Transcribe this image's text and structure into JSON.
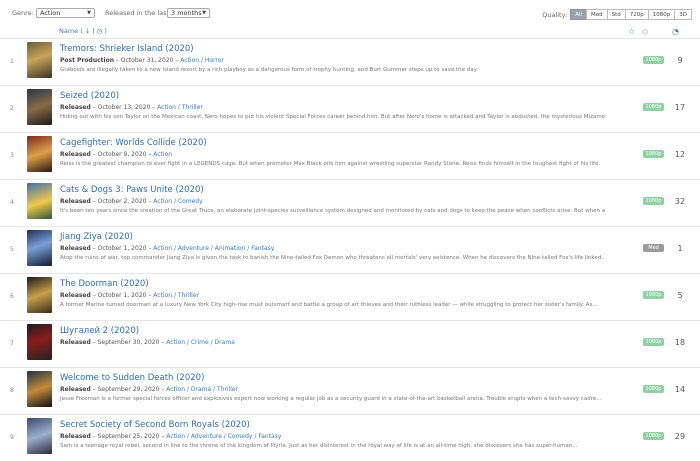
{
  "filters": {
    "genre_label": "Genre:",
    "genre_value": "Action",
    "released_label": "Released in the last:",
    "released_value": "3 months",
    "quality_label": "Quality:",
    "quality_options": [
      "All",
      "Med",
      "Std",
      "720p",
      "1080p",
      "3D"
    ],
    "quality_selected": "All"
  },
  "header": {
    "sort_label": "Name ( ↓ | ◷ )",
    "icons": [
      "star-thumbs-icon",
      "tag-icon",
      "pie-icon"
    ]
  },
  "colors": {
    "accent": "#3b7bbf",
    "badge_1080p": "#8fd1a3",
    "badge_med": "#9a9a9a"
  },
  "movies": [
    {
      "rank": "1",
      "title": "Tremors: Shrieker Island (2020)",
      "status": "Post Production",
      "date": "October 31, 2020",
      "genres": "Action / Horror",
      "desc": "Graboids are illegally taken to a new island resort by a rich playboy as a dangerous form of trophy hunting, and Burt Gummer steps up to save the day.",
      "quality": "1080p",
      "count": "9"
    },
    {
      "rank": "2",
      "title": "Seized (2020)",
      "status": "Released",
      "date": "October 13, 2020",
      "genres": "Action / Thriller",
      "desc": "Hiding out with his son Taylor on the Mexican coast, Nero hopes to put his violent Special Forces career behind him. But after Nero's home is attacked and Taylor is abducted, the mysterious Mizamo...",
      "quality": "1080p",
      "count": "17"
    },
    {
      "rank": "3",
      "title": "Cagefighter: Worlds Collide (2020)",
      "status": "Released",
      "date": "October 9, 2020",
      "genres": "Action",
      "desc": "Reiss is the greatest champion to ever fight in a LEGENDS cage. But when promoter Max Black pits him against wrestling superstar Randy Stone, Reiss finds himself in the toughest fight of his life.",
      "quality": "1080p",
      "count": "12"
    },
    {
      "rank": "4",
      "title": "Cats & Dogs 3: Paws Unite (2020)",
      "status": "Released",
      "date": "October 2, 2020",
      "genres": "Action / Comedy",
      "desc": "It's been ten years since the creation of the Great Truce, an elaborate joint-species surveillance system designed and monitored by cats and dogs to keep the peace when conflicts arise. But when a...",
      "quality": "1080p",
      "count": "32"
    },
    {
      "rank": "5",
      "title": "Jiang Ziya (2020)",
      "status": "Released",
      "date": "October 1, 2020",
      "genres": "Action / Adventure / Animation / Fantasy",
      "desc": "Atop the ruins of war, top commander Jiang Ziya is given the task to banish the Nine-tailed Fox Demon who threatens all mortals' very existence. When he discovers the Nine-tailed Fox's life linked...",
      "quality": "Med",
      "count": "1"
    },
    {
      "rank": "6",
      "title": "The Doorman (2020)",
      "status": "Released",
      "date": "October 1, 2020",
      "genres": "Action / Thriller",
      "desc": "A former Marine turned doorman at a luxury New York City high-rise must outsmart and battle a group of art thieves and their ruthless leader — while struggling to protect her sister's family. As...",
      "quality": "1080p",
      "count": "5"
    },
    {
      "rank": "7",
      "title": "Шугалей 2 (2020)",
      "status": "Released",
      "date": "September 30, 2020",
      "genres": "Action / Crime / Drama",
      "desc": "",
      "quality": "1080p",
      "count": "18"
    },
    {
      "rank": "8",
      "title": "Welcome to Sudden Death (2020)",
      "status": "Released",
      "date": "September 29, 2020",
      "genres": "Action / Drama / Thriller",
      "desc": "Jesse Freeman is a former special forces officer and explosives expert now working a regular job as a security guard in a state-of-the-art basketball arena. Trouble erupts when a tech-savvy cadre...",
      "quality": "1080p",
      "count": "14"
    },
    {
      "rank": "9",
      "title": "Secret Society of Second Born Royals (2020)",
      "status": "Released",
      "date": "September 25, 2020",
      "genres": "Action / Adventure / Comedy / Fantasy",
      "desc": "Sam is a teenage royal rebel, second in line to the throne of the kingdom of Illyria. Just as her disinterest in the royal way of life is at an all-time high, she discovers she has super-human...",
      "quality": "1080p",
      "count": "29"
    }
  ]
}
